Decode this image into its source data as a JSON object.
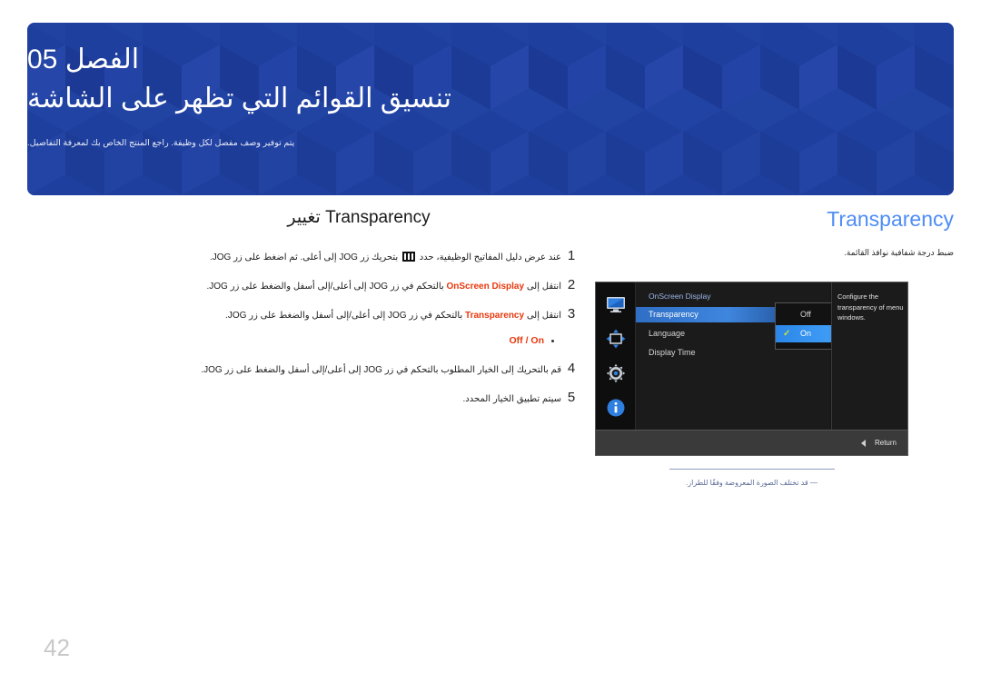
{
  "banner": {
    "chapter": "الفصل 05",
    "title": "تنسيق القوائم التي تظهر على الشاشة",
    "subtitle": "يتم توفير وصف مفصل لكل وظيفة. راجع المنتج الخاص بك لمعرفة التفاصيل.",
    "bg_color": "#1f3f9e"
  },
  "left": {
    "heading_ar": "تغيير",
    "heading_en": "Transparency",
    "steps": [
      {
        "num": "1",
        "pre": "عند عرض دليل المفاتيح الوظيفية، حدد ",
        "post": " بتحريك زر JOG إلى أعلى. ثم اضغط على زر JOG.",
        "icon": "menu-bars-icon"
      },
      {
        "num": "2",
        "pre": "انتقل إلى ",
        "kw": "OnScreen Display",
        "post": " بالتحكم في زر JOG إلى أعلى/إلى أسفل والضغط على زر JOG."
      },
      {
        "num": "3",
        "pre": "انتقل إلى ",
        "kw": "Transparency",
        "post": " بالتحكم في زر JOG إلى أعلى/إلى أسفل والضغط على زر JOG."
      }
    ],
    "bullet": "Off / On",
    "steps_tail": [
      {
        "num": "4",
        "text": "قم بالتحريك إلى الخيار المطلوب بالتحكم في زر JOG إلى أعلى/إلى أسفل والضغط على زر JOG."
      },
      {
        "num": "5",
        "text": "سيتم تطبيق الخيار المحدد."
      }
    ]
  },
  "right": {
    "title": "Transparency",
    "title_color": "#4e8df5",
    "description": "ضبط درجة شفافية نوافذ القائمة."
  },
  "osd": {
    "panel_title": "OnScreen Display",
    "items": [
      {
        "label": "Transparency",
        "selected": true
      },
      {
        "label": "Language",
        "selected": false
      },
      {
        "label": "Display Time",
        "selected": false
      }
    ],
    "dropdown": [
      {
        "label": "Off",
        "checked": false
      },
      {
        "label": "On",
        "checked": true
      }
    ],
    "check_glyph": "✓",
    "description": "Configure the transparency of menu windows.",
    "return_label": "Return",
    "sidebar_icons": [
      "display-icon",
      "resize-arrows-icon",
      "gear-icon",
      "info-icon"
    ]
  },
  "footnote": "― قد تختلف الصورة المعروضة وفقًا للطراز.",
  "page_number": "42"
}
